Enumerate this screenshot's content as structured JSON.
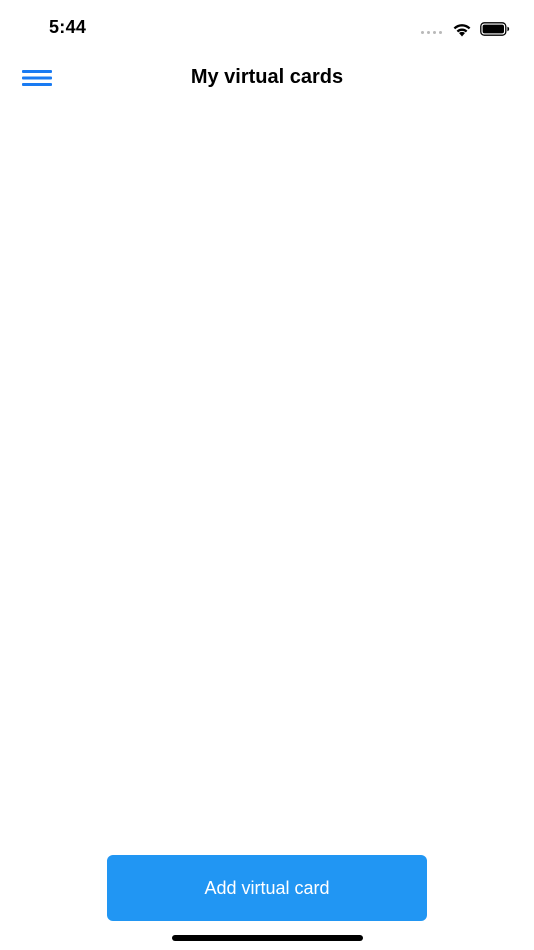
{
  "status_bar": {
    "time": "5:44",
    "signal_icon": "signal-dots-icon",
    "wifi_icon": "wifi-icon",
    "battery_icon": "battery-icon"
  },
  "nav_bar": {
    "menu_icon": "hamburger-menu-icon",
    "title": "My virtual cards"
  },
  "main": {
    "add_button_label": "Add virtual card"
  },
  "colors": {
    "accent": "#2196f3",
    "menu_icon": "#1a7bf2",
    "text": "#000000",
    "background": "#ffffff"
  }
}
